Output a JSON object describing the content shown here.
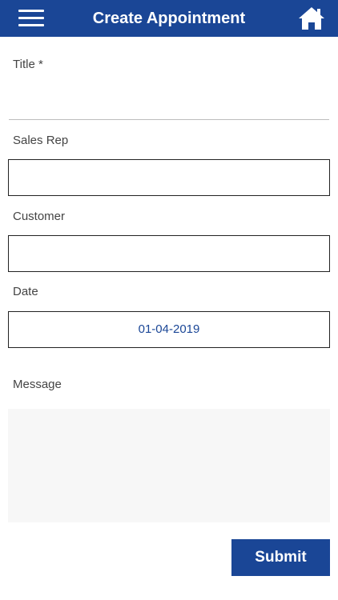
{
  "header": {
    "title": "Create Appointment",
    "menu_icon": "hamburger-menu-icon",
    "home_icon": "home-icon",
    "background_color": "#1a4696"
  },
  "form": {
    "title_label": "Title *",
    "title_value": "",
    "sales_rep_label": "Sales Rep",
    "sales_rep_value": "",
    "customer_label": "Customer",
    "customer_value": "",
    "date_label": "Date",
    "date_value": "01-04-2019",
    "message_label": "Message",
    "message_value": "",
    "submit_label": "Submit"
  },
  "colors": {
    "accent": "#1a4696",
    "message_bg": "#f7f7f7"
  }
}
